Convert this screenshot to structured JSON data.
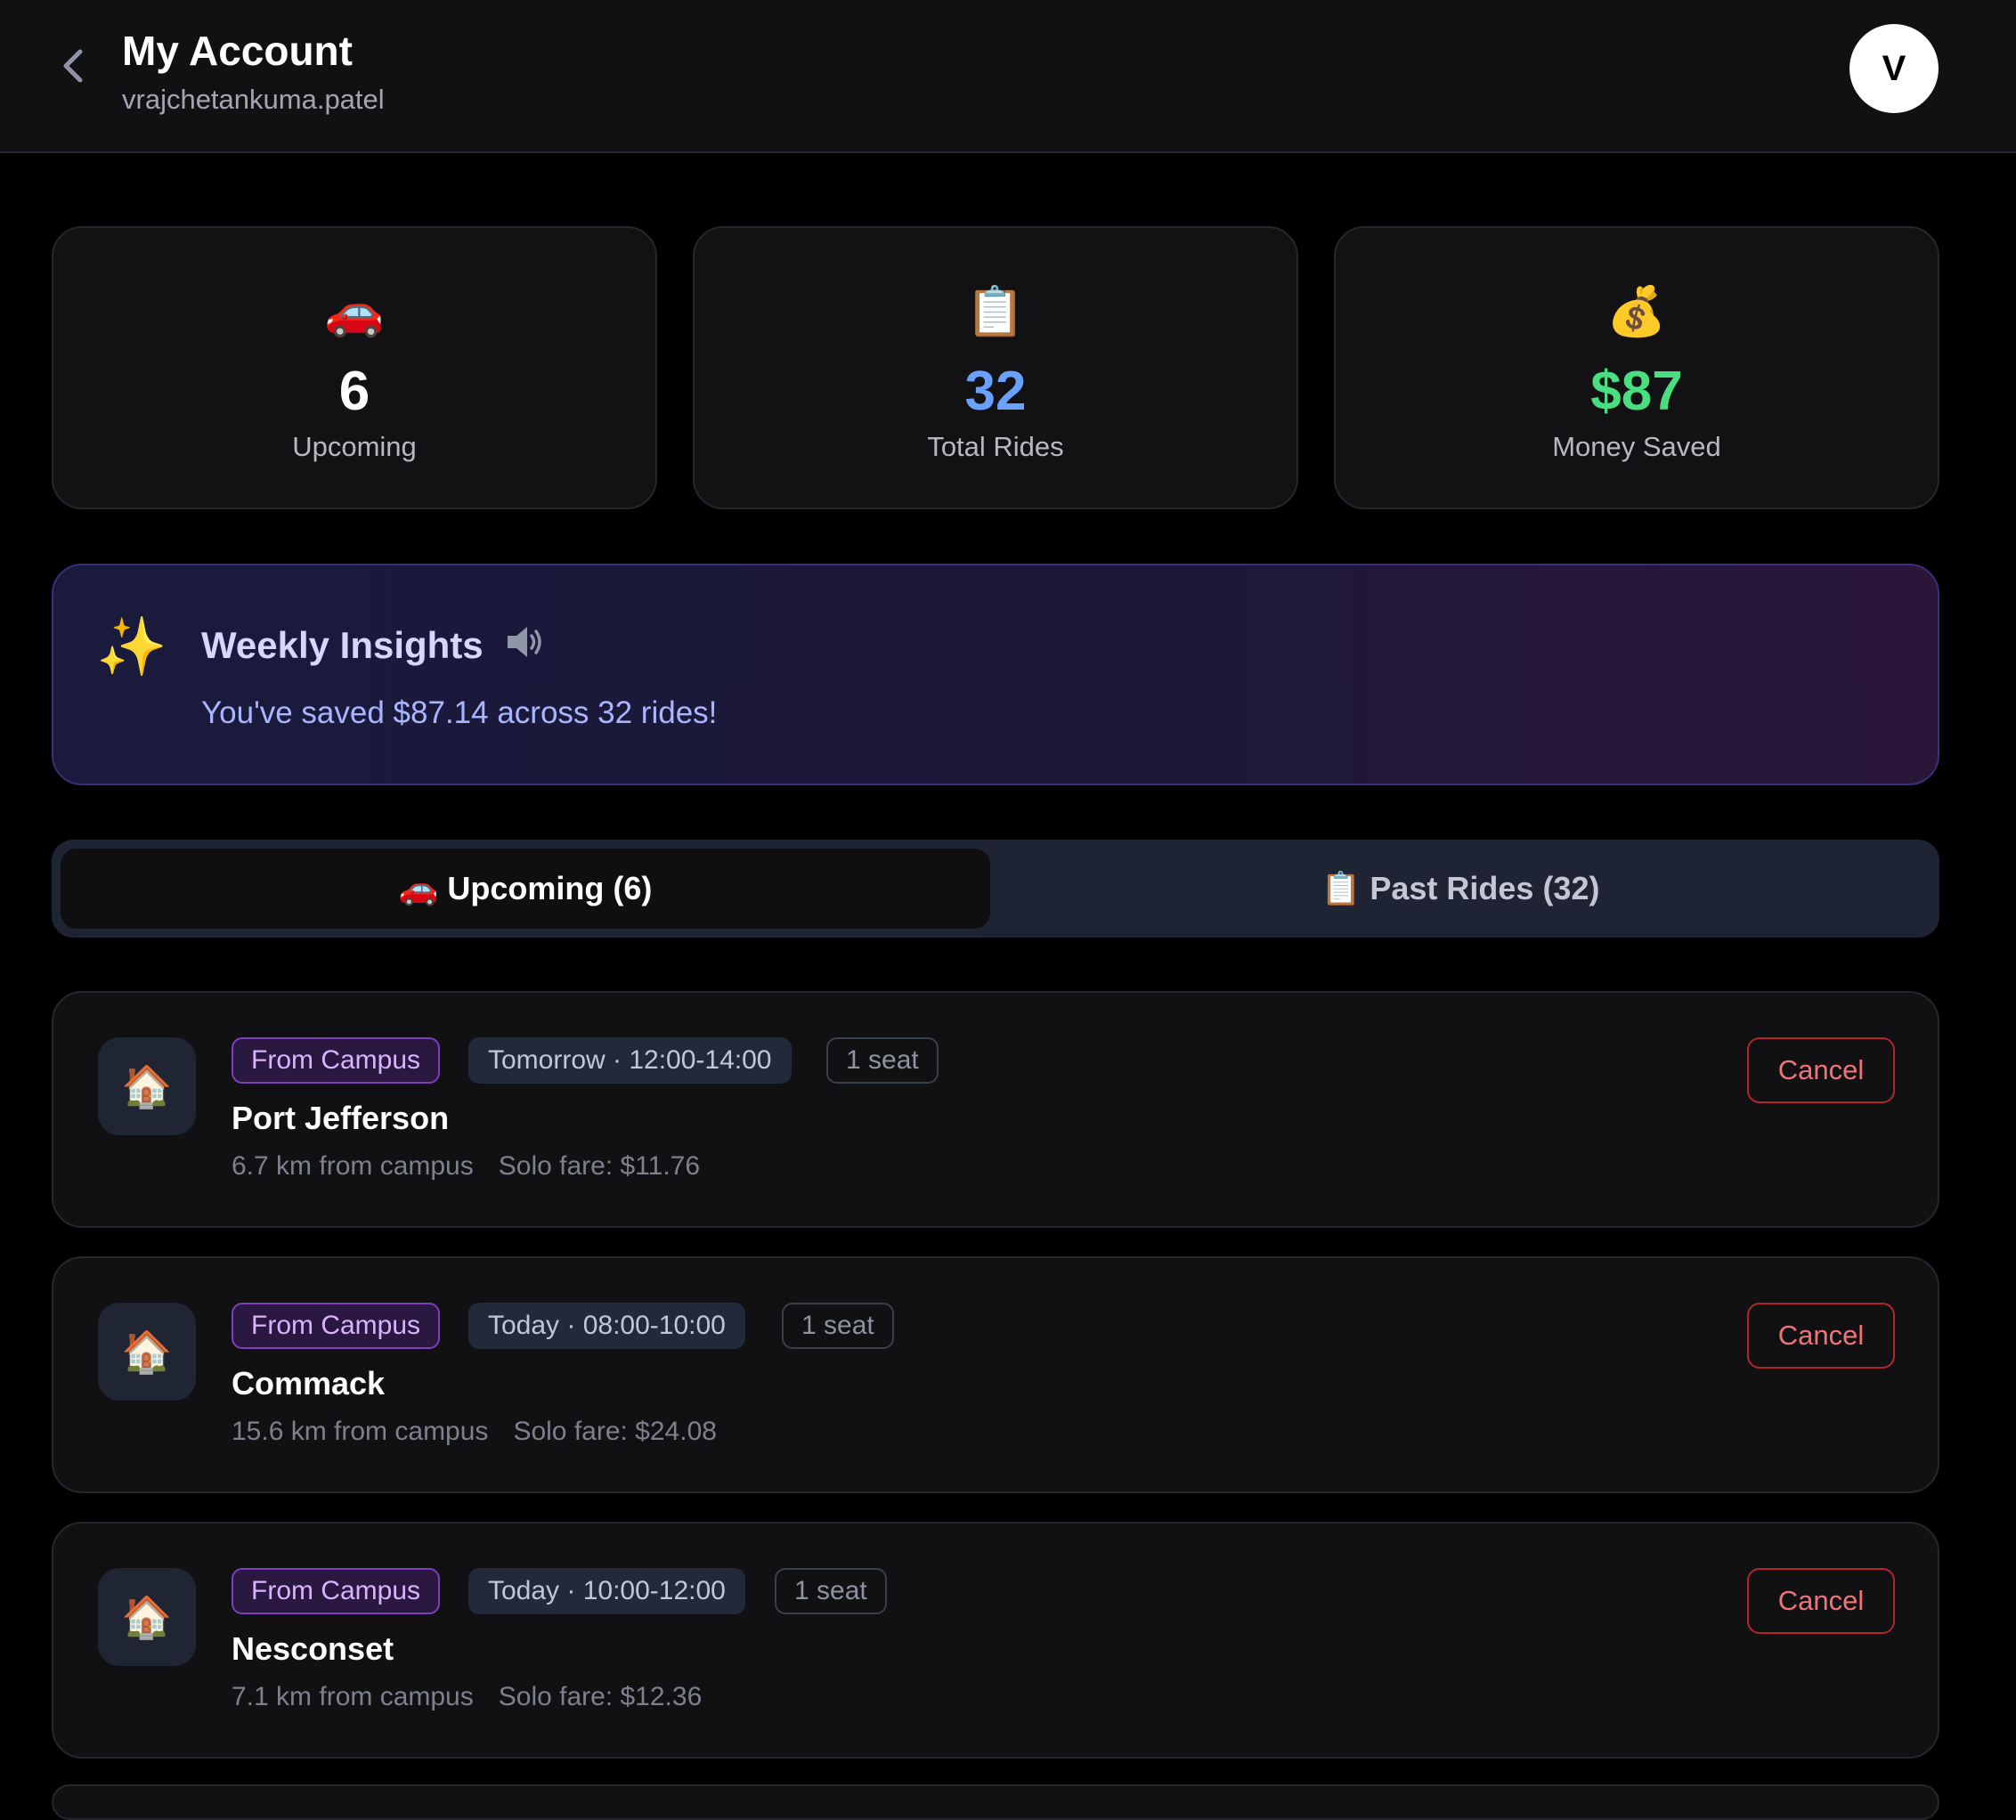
{
  "header": {
    "title": "My Account",
    "username": "vrajchetankuma.patel",
    "avatar_initial": "V"
  },
  "stats": [
    {
      "icon": "🚗",
      "icon_name": "car-icon",
      "value": "6",
      "label": "Upcoming",
      "color": "#ffffff"
    },
    {
      "icon": "📋",
      "icon_name": "clipboard-icon",
      "value": "32",
      "label": "Total Rides",
      "color": "#6aa0ff"
    },
    {
      "icon": "💰",
      "icon_name": "money-bag-icon",
      "value": "$87",
      "label": "Money Saved",
      "color": "#4ade80"
    }
  ],
  "insights": {
    "icon": "✨",
    "title": "Weekly Insights",
    "message": "You've saved $87.14 across 32 rides!"
  },
  "tabs": {
    "upcoming": {
      "icon": "🚗",
      "label": "Upcoming (6)"
    },
    "past": {
      "icon": "📋",
      "label": "Past Rides (32)"
    }
  },
  "rides": [
    {
      "icon": "🏠",
      "direction": "From Campus",
      "time": "Tomorrow · 12:00-14:00",
      "seats": "1 seat",
      "destination": "Port Jefferson",
      "distance": "6.7 km from campus",
      "fare": "Solo fare: $11.76",
      "cancel_label": "Cancel"
    },
    {
      "icon": "🏠",
      "direction": "From Campus",
      "time": "Today · 08:00-10:00",
      "seats": "1 seat",
      "destination": "Commack",
      "distance": "15.6 km from campus",
      "fare": "Solo fare: $24.08",
      "cancel_label": "Cancel"
    },
    {
      "icon": "🏠",
      "direction": "From Campus",
      "time": "Today · 10:00-12:00",
      "seats": "1 seat",
      "destination": "Nesconset",
      "distance": "7.1 km from campus",
      "fare": "Solo fare: $12.36",
      "cancel_label": "Cancel"
    }
  ]
}
